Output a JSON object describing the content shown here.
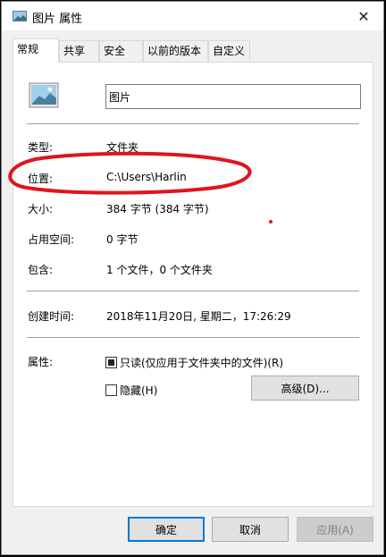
{
  "window": {
    "title": "图片 属性",
    "close_glyph": "✕"
  },
  "tabs": [
    {
      "label": "常规",
      "active": true
    },
    {
      "label": "共享",
      "active": false
    },
    {
      "label": "安全",
      "active": false
    },
    {
      "label": "以前的版本",
      "active": false
    },
    {
      "label": "自定义",
      "active": false
    }
  ],
  "general": {
    "folder_name": "图片",
    "type_label": "类型:",
    "type_value": "文件夹",
    "location_label": "位置:",
    "location_value": "C:\\Users\\Harlin",
    "size_label": "大小:",
    "size_value": "384 字节 (384 字节)",
    "disk_size_label": "占用空间:",
    "disk_size_value": "0 字节",
    "contains_label": "包含:",
    "contains_value": "1 个文件，0 个文件夹",
    "created_label": "创建时间:",
    "created_value": "2018年11月20日, 星期二，17:26:29",
    "attributes_label": "属性:",
    "readonly_label": "只读(仅应用于文件夹中的文件)(R)",
    "readonly_checked": true,
    "hidden_label": "隐藏(H)",
    "hidden_checked": false,
    "advanced_label": "高级(D)..."
  },
  "buttons": {
    "ok": "确定",
    "cancel": "取消",
    "apply": "应用(A)"
  },
  "colors": {
    "annotation_red": "#e0141e",
    "focus_blue": "#0078d7"
  }
}
